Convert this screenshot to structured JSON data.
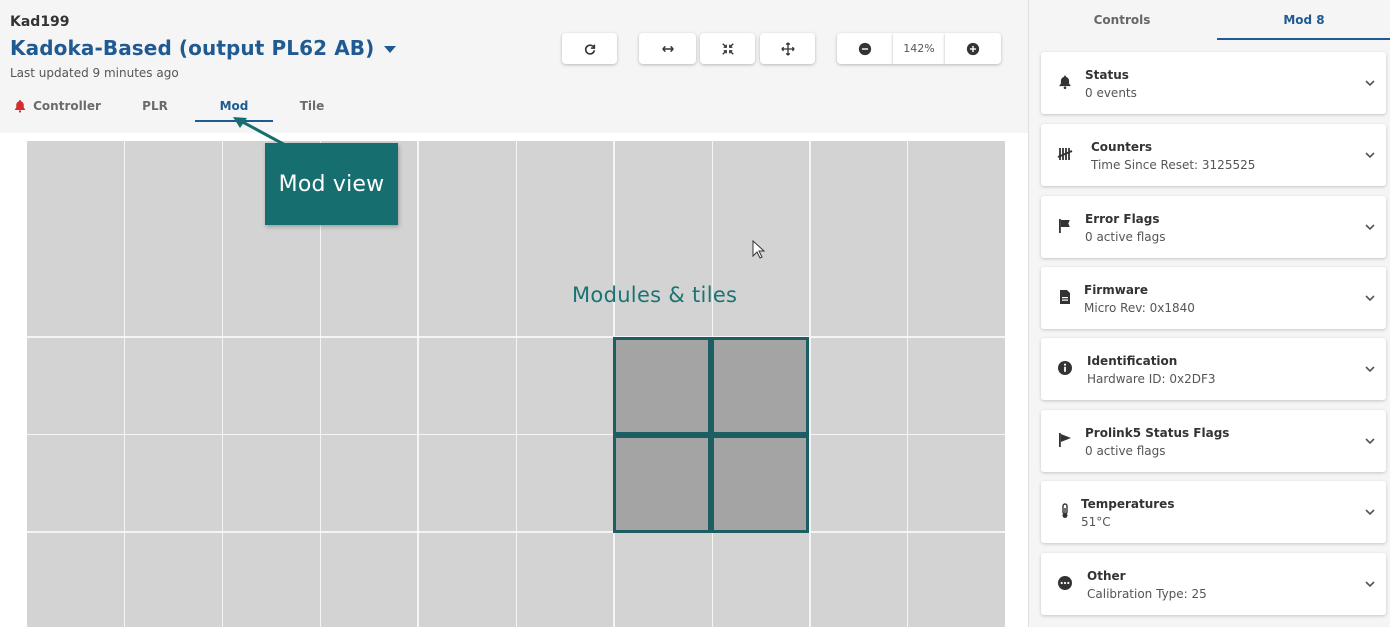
{
  "header": {
    "device_id": "Kad199",
    "title": "Kadoka-Based (output PL62 AB)",
    "last_updated": "Last updated 9 minutes ago",
    "tabs": [
      {
        "label": "Controller",
        "icon": "alert-icon"
      },
      {
        "label": "PLR"
      },
      {
        "label": "Mod"
      },
      {
        "label": "Tile"
      }
    ],
    "active_tab": "Mod"
  },
  "toolbar": {
    "buttons": [
      {
        "name": "refresh-button",
        "icon": "refresh-icon"
      },
      {
        "name": "fit-horizontal-button",
        "icon": "arrows-horizontal-icon"
      },
      {
        "name": "collapse-button",
        "icon": "compress-icon"
      },
      {
        "name": "move-button",
        "icon": "move-icon"
      },
      {
        "name": "zoom-out-button",
        "icon": "minus-circle-icon"
      },
      {
        "name": "zoom-in-button",
        "icon": "plus-circle-icon"
      }
    ],
    "zoom_level": "142%"
  },
  "annotations": {
    "callout": "Mod view",
    "modules_label": "Modules & tiles"
  },
  "panel": {
    "tabs": [
      {
        "label": "Controls"
      },
      {
        "label": "Mod 8"
      }
    ],
    "active_tab": "Mod 8",
    "cards": [
      {
        "title": "Status",
        "subtitle": "0 events",
        "icon": "bell-icon"
      },
      {
        "title": "Counters",
        "subtitle": "Time Since Reset: 3125525",
        "icon": "tally-icon"
      },
      {
        "title": "Error Flags",
        "subtitle": "0 active flags",
        "icon": "flag-icon"
      },
      {
        "title": "Firmware",
        "subtitle": "Micro Rev: 0x1840",
        "icon": "file-icon"
      },
      {
        "title": "Identification",
        "subtitle": "Hardware ID: 0x2DF3",
        "icon": "info-icon"
      },
      {
        "title": "Prolink5 Status Flags",
        "subtitle": "0 active flags",
        "icon": "pennant-icon"
      },
      {
        "title": "Temperatures",
        "subtitle": "51°C",
        "icon": "thermometer-icon"
      },
      {
        "title": "Other",
        "subtitle": "Calibration Type: 25",
        "icon": "more-icon"
      }
    ]
  },
  "colors": {
    "primary": "#1f5a92",
    "accent_teal": "#176e6f",
    "grid": "#d3d3d3",
    "tile": "#a4a4a4",
    "alert": "#d32f2f"
  }
}
